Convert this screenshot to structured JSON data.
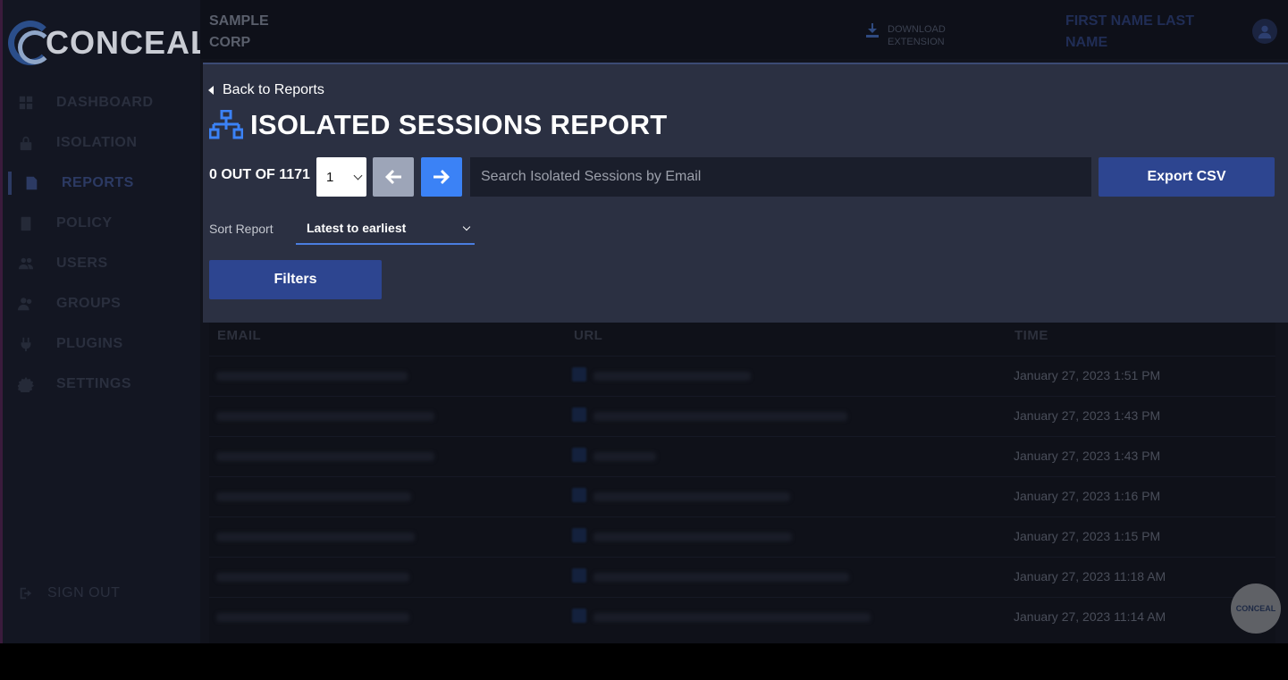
{
  "app": {
    "brand": "CONCEAL",
    "org": "SAMPLE CORP",
    "download_label": "DOWNLOAD EXTENSION",
    "user_name": "FIRST NAME LAST NAME",
    "colors": {
      "accent": "#3b82f6",
      "primary_button": "#2d4590",
      "panel": "#2b3042"
    }
  },
  "sidebar": {
    "items": [
      {
        "label": "DASHBOARD",
        "icon": "grid-icon"
      },
      {
        "label": "ISOLATION",
        "icon": "lock-icon"
      },
      {
        "label": "REPORTS",
        "icon": "document-icon",
        "active": true
      },
      {
        "label": "POLICY",
        "icon": "clipboard-icon"
      },
      {
        "label": "USERS",
        "icon": "users-icon"
      },
      {
        "label": "GROUPS",
        "icon": "group-icon"
      },
      {
        "label": "PLUGINS",
        "icon": "plug-icon"
      },
      {
        "label": "SETTINGS",
        "icon": "gear-icon"
      }
    ],
    "sign_out": "SIGN OUT"
  },
  "report": {
    "back_label": "Back to Reports",
    "title": "ISOLATED SESSIONS REPORT",
    "count_label": "0 OUT OF 1171",
    "page_value": "1",
    "search_placeholder": "Search Isolated Sessions by Email",
    "export_label": "Export CSV",
    "sort_label": "Sort Report",
    "sort_value": "Latest to earliest",
    "filters_label": "Filters"
  },
  "table": {
    "columns": [
      "EMAIL",
      "URL",
      "TIME"
    ],
    "rows": [
      {
        "time": "January 27, 2023 1:51 PM"
      },
      {
        "time": "January 27, 2023 1:43 PM"
      },
      {
        "time": "January 27, 2023 1:43 PM"
      },
      {
        "time": "January 27, 2023 1:16 PM"
      },
      {
        "time": "January 27, 2023 1:15 PM"
      },
      {
        "time": "January 27, 2023 11:18 AM"
      },
      {
        "time": "January 27, 2023 11:14 AM"
      }
    ]
  },
  "widget": {
    "label": "CONCEAL"
  }
}
